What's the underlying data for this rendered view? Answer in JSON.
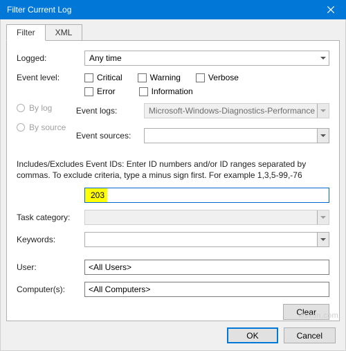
{
  "window": {
    "title": "Filter Current Log"
  },
  "tabs": {
    "filter": "Filter",
    "xml": "XML"
  },
  "fields": {
    "logged_label": "Logged:",
    "logged_value": "Any time",
    "event_level_label": "Event level:",
    "checks": {
      "critical": "Critical",
      "warning": "Warning",
      "verbose": "Verbose",
      "error": "Error",
      "information": "Information"
    },
    "by_log": "By log",
    "by_source": "By source",
    "event_logs_label": "Event logs:",
    "event_logs_value": "Microsoft-Windows-Diagnostics-Performance",
    "event_sources_label": "Event sources:",
    "desc": "Includes/Excludes Event IDs: Enter ID numbers and/or ID ranges separated by commas. To exclude criteria, type a minus sign first. For example 1,3,5-99,-76",
    "event_id_value": "203",
    "task_category_label": "Task category:",
    "keywords_label": "Keywords:",
    "user_label": "User:",
    "user_value": "<All Users>",
    "computers_label": "Computer(s):",
    "computers_value": "<All Computers>"
  },
  "buttons": {
    "clear": "Clear",
    "ok": "OK",
    "cancel": "Cancel"
  },
  "watermark": "wsxdn.com"
}
